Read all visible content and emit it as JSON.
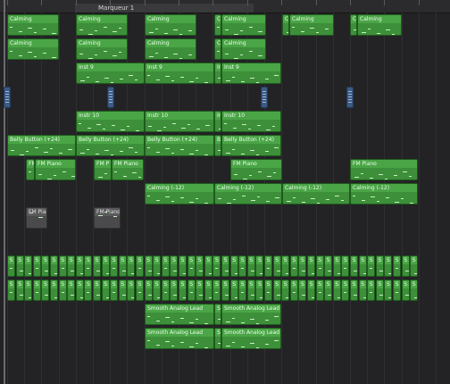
{
  "marker": {
    "label": "Marqueur 1"
  },
  "colors": {
    "region_green": "#3d8f3a",
    "region_header": "#4aa546",
    "audio_blue": "#3b5b86",
    "grey": "#4a4a4c"
  },
  "regions": {
    "calming": "Calming",
    "calming_short": "C",
    "inst9": "Inst 9",
    "inst9_short": "In",
    "instr10": "Instr 10",
    "instr10_short": "In",
    "belly": "Belly Button (+24)",
    "belly_short": "B",
    "fm_piano": "FM Piano",
    "fm_short": "FM",
    "fm_p": "FM P",
    "calming_m12": "Calming (-12)",
    "s": "S",
    "smooth": "Smooth Analog Lead",
    "smooth_short": "S"
  }
}
